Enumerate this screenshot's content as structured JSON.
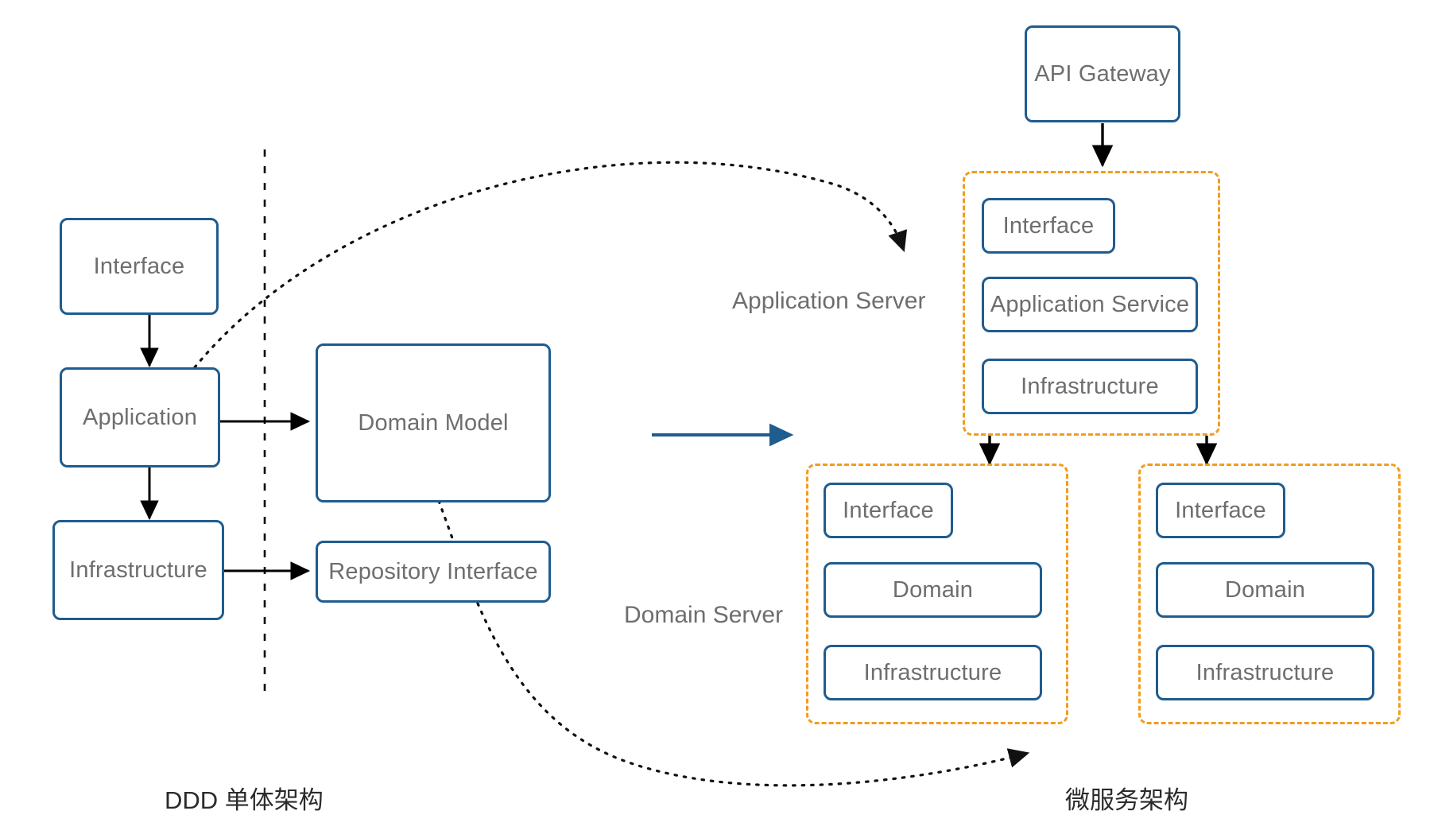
{
  "diagram": {
    "title_left": "DDD 单体架构",
    "title_right": "微服务架构",
    "monolith": {
      "interface": "Interface",
      "application": "Application",
      "infrastructure": "Infrastructure",
      "domain_model": "Domain Model",
      "repository_interface": "Repository Interface"
    },
    "microservices": {
      "api_gateway": "API Gateway",
      "application_server_label": "Application Server",
      "domain_server_label": "Domain Server",
      "app_server": {
        "interface": "Interface",
        "application_service": "Application Service",
        "infrastructure": "Infrastructure"
      },
      "domain_server_1": {
        "interface": "Interface",
        "domain": "Domain",
        "infrastructure": "Infrastructure"
      },
      "domain_server_2": {
        "interface": "Interface",
        "domain": "Domain",
        "infrastructure": "Infrastructure"
      }
    },
    "colors": {
      "box_border": "#1F5C8F",
      "group_border": "#F39C1F",
      "text": "#6e6e6e",
      "arrow": "#000000",
      "transition_arrow": "#1F5C8F",
      "background": "#ffffff"
    }
  }
}
